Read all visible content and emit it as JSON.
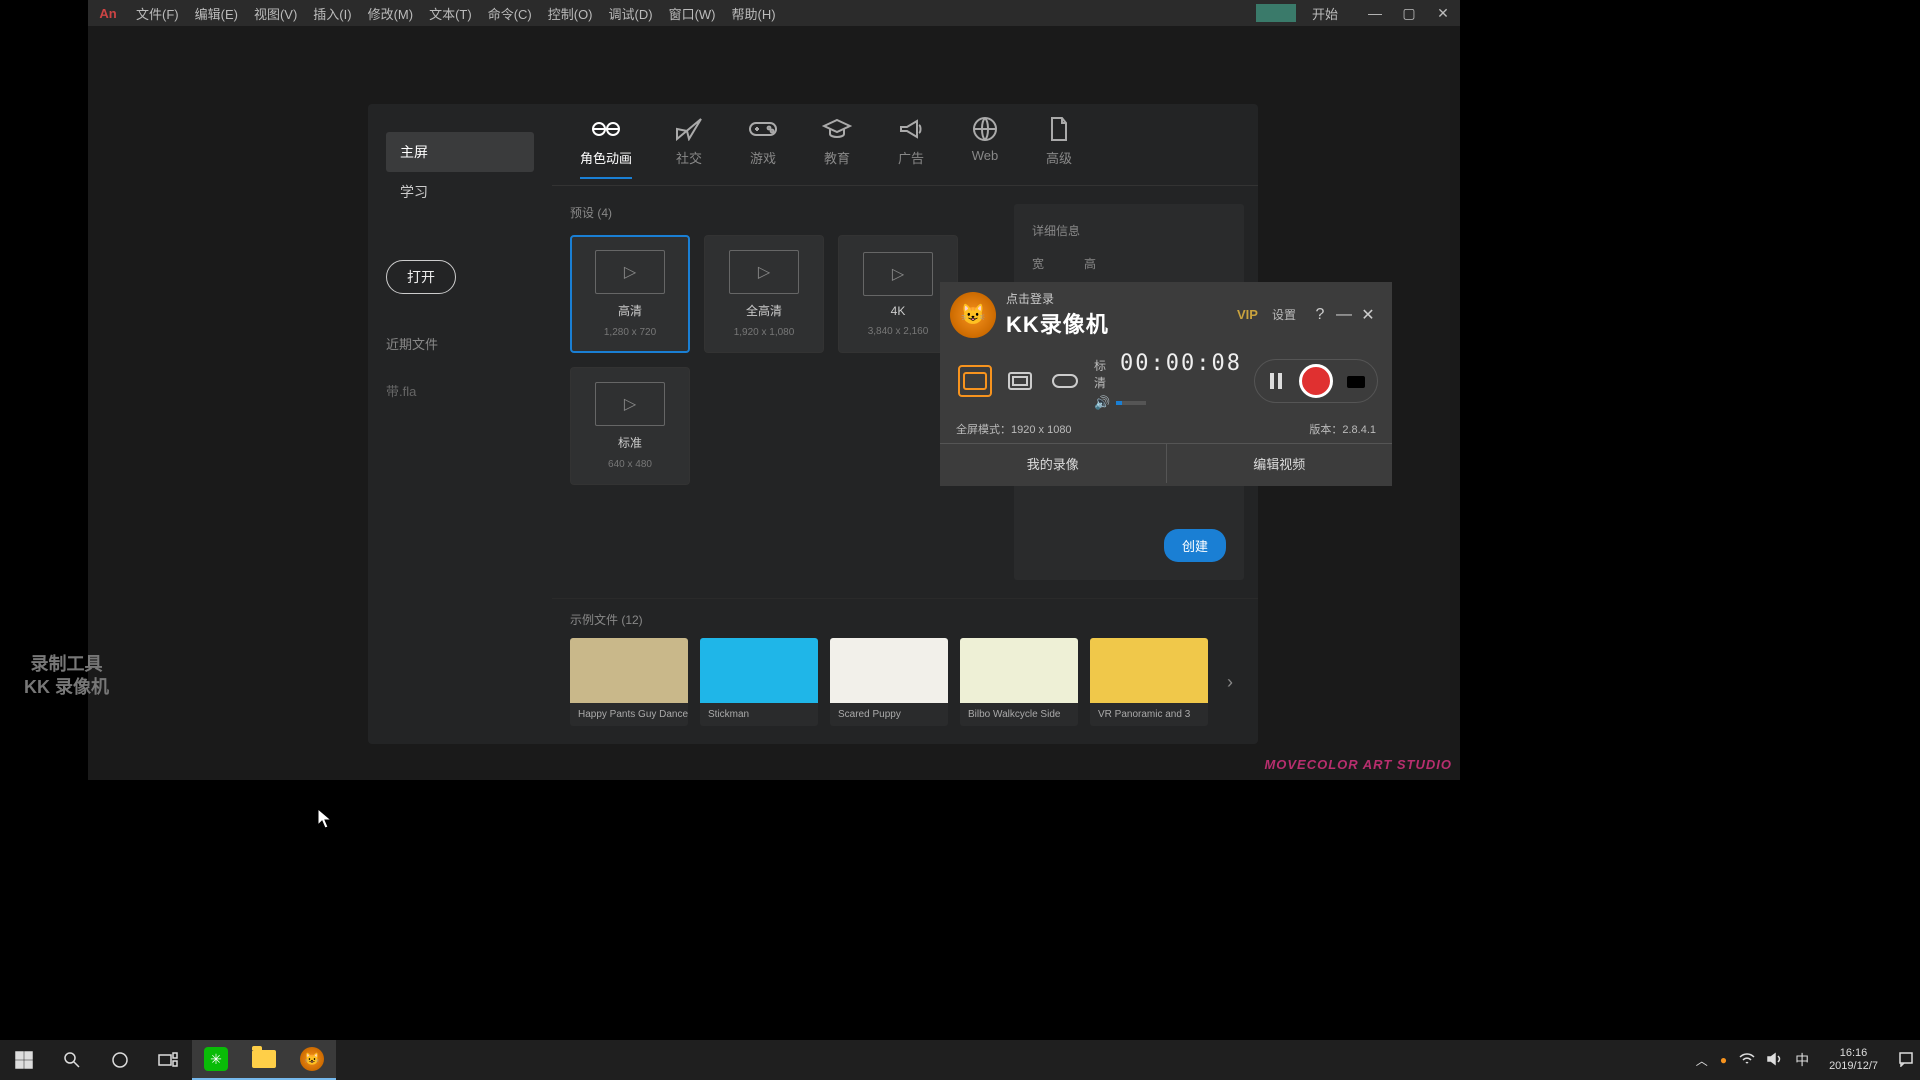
{
  "menubar": {
    "items": [
      "文件(F)",
      "编辑(E)",
      "视图(V)",
      "插入(I)",
      "修改(M)",
      "文本(T)",
      "命令(C)",
      "控制(O)",
      "调试(D)",
      "窗口(W)",
      "帮助(H)"
    ],
    "start": "开始"
  },
  "dialog": {
    "side": {
      "tabs": [
        "主屏",
        "学习"
      ],
      "open": "打开",
      "recent": "近期文件",
      "ext": "带.fla"
    },
    "categories": [
      {
        "label": "角色动画",
        "icon": "character"
      },
      {
        "label": "社交",
        "icon": "paperplane"
      },
      {
        "label": "游戏",
        "icon": "gamepad"
      },
      {
        "label": "教育",
        "icon": "gradcap"
      },
      {
        "label": "广告",
        "icon": "megaphone"
      },
      {
        "label": "Web",
        "icon": "globe"
      },
      {
        "label": "高级",
        "icon": "doc"
      }
    ],
    "presets_header": "预设 (4)",
    "presets": [
      {
        "name": "高清",
        "dim": "1,280 x 720",
        "sel": true
      },
      {
        "name": "全高清",
        "dim": "1,920 x 1,080",
        "sel": false
      },
      {
        "name": "4K",
        "dim": "3,840 x 2,160",
        "sel": false
      },
      {
        "name": "标准",
        "dim": "640 x 480",
        "sel": false
      }
    ],
    "detail": {
      "header": "详细信息",
      "w": "宽",
      "h": "高",
      "create": "创建"
    },
    "samples_header": "示例文件 (12)",
    "samples": [
      {
        "name": "Happy Pants Guy Dance",
        "bg": "#c9b88a"
      },
      {
        "name": "Stickman",
        "bg": "#1fb6e8"
      },
      {
        "name": "Scared Puppy",
        "bg": "#f2f0ea"
      },
      {
        "name": "Bilbo Walkcycle Side",
        "bg": "#eef0d6"
      },
      {
        "name": "VR Panoramic and 3",
        "bg": "#f0c84a"
      }
    ]
  },
  "kk": {
    "login": "点击登录",
    "title": "KK录像机",
    "vip": "VIP",
    "settings": "设置",
    "quality": "标清",
    "timer": "00:00:08",
    "status_mode": "全屏模式：1920 x 1080",
    "version": "版本：2.8.4.1",
    "btn_my": "我的录像",
    "btn_edit": "编辑视频"
  },
  "watermark": {
    "l1": "录制工具",
    "l2": "KK 录像机"
  },
  "studio": "MOVECOLOR ART STUDIO",
  "tray": {
    "ime": "中",
    "time": "16:16",
    "date": "2019/12/7"
  }
}
